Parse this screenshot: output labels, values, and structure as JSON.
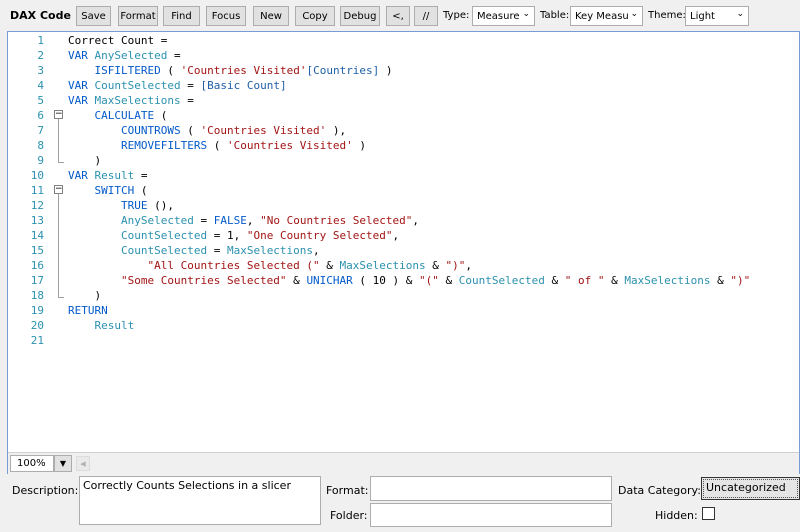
{
  "toolbar": {
    "title": "DAX Code",
    "buttons": [
      "Save",
      "Format",
      "Find",
      "Focus",
      "New",
      "Copy",
      "Debug",
      "<,",
      "//"
    ],
    "type_label": "Type:",
    "type_value": "Measure",
    "table_label": "Table:",
    "table_value": "Key Measu",
    "theme_label": "Theme:",
    "theme_value": "Light"
  },
  "editor": {
    "line_numbers": [
      "1",
      "2",
      "3",
      "4",
      "5",
      "6",
      "7",
      "8",
      "9",
      "10",
      "11",
      "12",
      "13",
      "14",
      "15",
      "16",
      "17",
      "18",
      "19",
      "20",
      "21"
    ],
    "zoom": "100%",
    "lines": [
      [
        [
          "plain",
          "Correct Count ="
        ]
      ],
      [
        [
          "kw",
          "VAR "
        ],
        [
          "var",
          "AnySelected"
        ],
        [
          "plain",
          " ="
        ]
      ],
      [
        [
          "plain",
          "    "
        ],
        [
          "fn",
          "ISFILTERED"
        ],
        [
          "plain",
          " ( "
        ],
        [
          "tbl",
          "'Countries Visited'"
        ],
        [
          "ref",
          "[Countries]"
        ],
        [
          "plain",
          " )"
        ]
      ],
      [
        [
          "kw",
          "VAR "
        ],
        [
          "var",
          "CountSelected"
        ],
        [
          "plain",
          " = "
        ],
        [
          "ref",
          "[Basic Count]"
        ]
      ],
      [
        [
          "kw",
          "VAR "
        ],
        [
          "var",
          "MaxSelections"
        ],
        [
          "plain",
          " ="
        ]
      ],
      [
        [
          "plain",
          "    "
        ],
        [
          "fn",
          "CALCULATE"
        ],
        [
          "plain",
          " ("
        ]
      ],
      [
        [
          "plain",
          "        "
        ],
        [
          "fn",
          "COUNTROWS"
        ],
        [
          "plain",
          " ( "
        ],
        [
          "tbl",
          "'Countries Visited'"
        ],
        [
          "plain",
          " ),"
        ]
      ],
      [
        [
          "plain",
          "        "
        ],
        [
          "fn",
          "REMOVEFILTERS"
        ],
        [
          "plain",
          " ( "
        ],
        [
          "tbl",
          "'Countries Visited'"
        ],
        [
          "plain",
          " )"
        ]
      ],
      [
        [
          "plain",
          "    )"
        ]
      ],
      [
        [
          "kw",
          "VAR "
        ],
        [
          "var",
          "Result"
        ],
        [
          "plain",
          " ="
        ]
      ],
      [
        [
          "plain",
          "    "
        ],
        [
          "fn",
          "SWITCH"
        ],
        [
          "plain",
          " ("
        ]
      ],
      [
        [
          "plain",
          "        "
        ],
        [
          "fn",
          "TRUE"
        ],
        [
          "plain",
          " (),"
        ]
      ],
      [
        [
          "plain",
          "        "
        ],
        [
          "var",
          "AnySelected"
        ],
        [
          "plain",
          " = "
        ],
        [
          "fn",
          "FALSE"
        ],
        [
          "plain",
          ", "
        ],
        [
          "str",
          "\"No Countries Selected\""
        ],
        [
          "plain",
          ","
        ]
      ],
      [
        [
          "plain",
          "        "
        ],
        [
          "var",
          "CountSelected"
        ],
        [
          "plain",
          " = 1, "
        ],
        [
          "str",
          "\"One Country Selected\""
        ],
        [
          "plain",
          ","
        ]
      ],
      [
        [
          "plain",
          "        "
        ],
        [
          "var",
          "CountSelected"
        ],
        [
          "plain",
          " = "
        ],
        [
          "var",
          "MaxSelections"
        ],
        [
          "plain",
          ","
        ]
      ],
      [
        [
          "plain",
          "            "
        ],
        [
          "str",
          "\"All Countries Selected (\""
        ],
        [
          "plain",
          " & "
        ],
        [
          "var",
          "MaxSelections"
        ],
        [
          "plain",
          " & "
        ],
        [
          "str",
          "\")\""
        ],
        [
          "plain",
          ","
        ]
      ],
      [
        [
          "plain",
          "        "
        ],
        [
          "str",
          "\"Some Countries Selected\""
        ],
        [
          "plain",
          " & "
        ],
        [
          "fn",
          "UNICHAR"
        ],
        [
          "plain",
          " ( 10 ) & "
        ],
        [
          "str",
          "\"(\""
        ],
        [
          "plain",
          " & "
        ],
        [
          "var",
          "CountSelected"
        ],
        [
          "plain",
          " & "
        ],
        [
          "str",
          "\" of \""
        ],
        [
          "plain",
          " & "
        ],
        [
          "var",
          "MaxSelections"
        ],
        [
          "plain",
          " & "
        ],
        [
          "str",
          "\")\""
        ]
      ],
      [
        [
          "plain",
          "    )"
        ]
      ],
      [
        [
          "kw",
          "RETURN"
        ]
      ],
      [
        [
          "plain",
          "    "
        ],
        [
          "var",
          "Result"
        ]
      ],
      [
        [
          "plain",
          ""
        ]
      ]
    ]
  },
  "properties": {
    "description_label": "Description:",
    "description_value": "Correctly Counts Selections in a slicer",
    "format_label": "Format:",
    "format_value": "",
    "folder_label": "Folder:",
    "folder_value": "",
    "data_category_label": "Data Category:",
    "data_category_value": "Uncategorized",
    "hidden_label": "Hidden:",
    "hidden_checked": false
  }
}
